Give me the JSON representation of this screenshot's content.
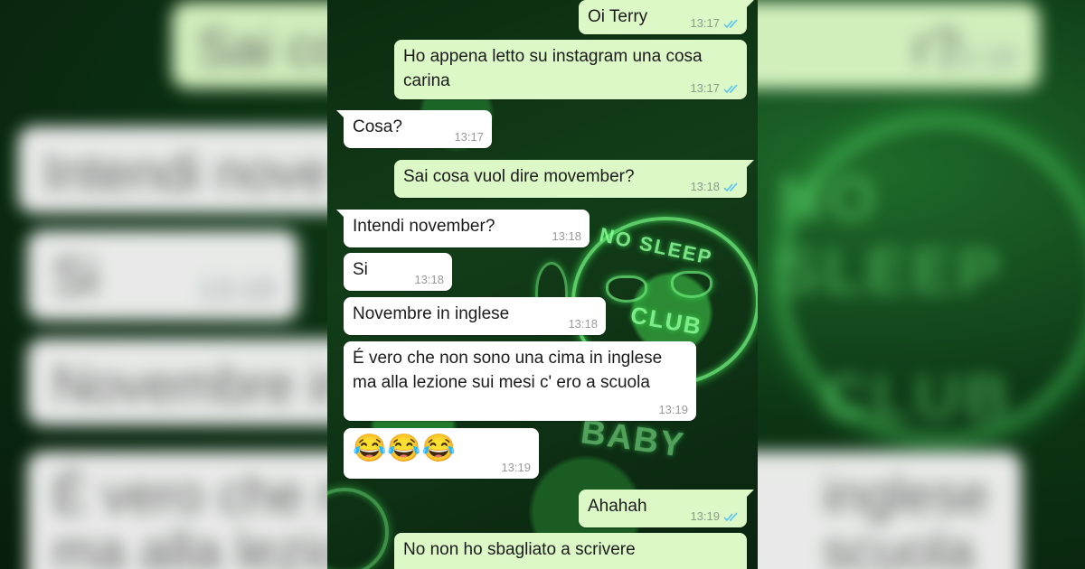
{
  "colors": {
    "outgoing_bubble": "#dcf8c6",
    "incoming_bubble": "#ffffff",
    "read_ticks": "#4fc3f7",
    "neon_green": "#6ff07c"
  },
  "wallpaper": {
    "neon_sign_top": "NO SLEEP",
    "neon_sign_bottom": "CLUB",
    "neon_sign_baby": "BABY"
  },
  "messages": [
    {
      "direction": "out",
      "text": "Oi Terry",
      "time": "13:17",
      "status": "read"
    },
    {
      "direction": "out",
      "text": "Ho appena letto su instagram una cosa\ncarina",
      "time": "13:17",
      "status": "read"
    },
    {
      "direction": "in",
      "text": "Cosa?",
      "time": "13:17"
    },
    {
      "direction": "out",
      "text": "Sai cosa vuol dire movember?",
      "time": "13:18",
      "status": "read"
    },
    {
      "direction": "in",
      "text": "Intendi november?",
      "time": "13:18"
    },
    {
      "direction": "in",
      "text": "Si",
      "time": "13:18"
    },
    {
      "direction": "in",
      "text": "Novembre in inglese",
      "time": "13:18"
    },
    {
      "direction": "in",
      "text": "É vero che non sono una cima in inglese\nma alla lezione sui mesi c' ero a scuola",
      "time": "13:19"
    },
    {
      "direction": "in",
      "text": "😂😂😂",
      "time": "13:19"
    },
    {
      "direction": "out",
      "text": "Ahahah",
      "time": "13:19",
      "status": "read"
    },
    {
      "direction": "out",
      "text": "No non ho sbagliato a scrivere",
      "time": ""
    }
  ],
  "blurred_background": {
    "left": [
      "Intendi nove",
      "Si",
      "Novembre in",
      "É vero che no",
      "ma alla lezio"
    ],
    "left_times": [
      "13:18"
    ],
    "right": [
      "Sai co",
      "r?",
      "inglese",
      "scuola"
    ],
    "right_times": [
      "13:18"
    ]
  }
}
